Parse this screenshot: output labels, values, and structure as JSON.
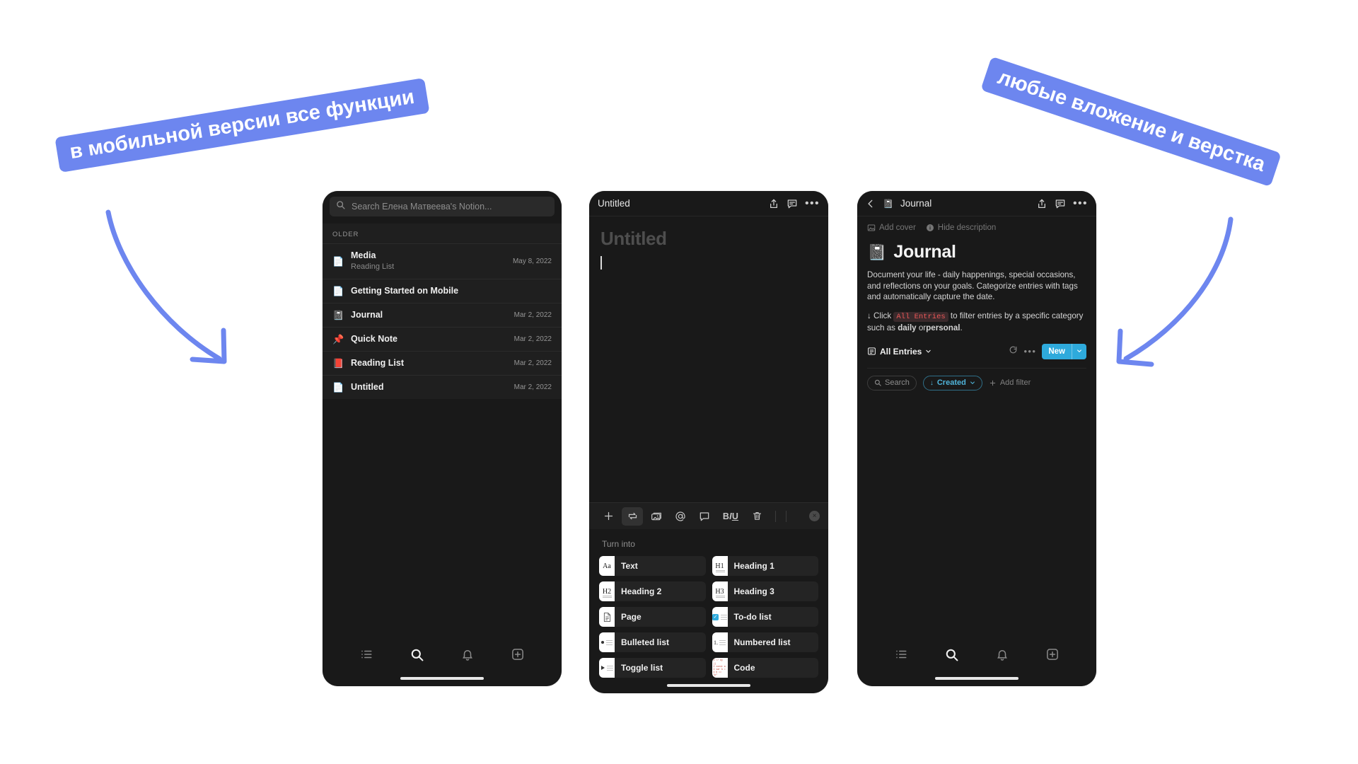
{
  "annotations": {
    "left_banner": "в мобильной версии все функции",
    "right_banner": "любые вложение и верстка",
    "accent_color": "#6d86ef"
  },
  "phone_search": {
    "search": {
      "placeholder": "Search Елена Матвеева's Notion...",
      "icon": "search-icon",
      "value": ""
    },
    "section_label": "OLDER",
    "results": [
      {
        "icon": "page-icon",
        "emoji": "📄",
        "name": "Media",
        "subtitle": "Reading List",
        "date": "May 8, 2022"
      },
      {
        "icon": "page-icon",
        "emoji": "📄",
        "name": "Getting Started on Mobile",
        "subtitle": "",
        "date": ""
      },
      {
        "icon": "notebook-icon",
        "emoji": "📓",
        "name": "Journal",
        "subtitle": "",
        "date": "Mar 2, 2022"
      },
      {
        "icon": "pushpin-icon",
        "emoji": "📌",
        "name": "Quick Note",
        "subtitle": "",
        "date": "Mar 2, 2022"
      },
      {
        "icon": "book-icon",
        "emoji": "📕",
        "name": "Reading List",
        "subtitle": "",
        "date": "Mar 2, 2022"
      },
      {
        "icon": "blank-page-icon",
        "emoji": "📄",
        "name": "Untitled",
        "subtitle": "",
        "date": "Mar 2, 2022"
      }
    ],
    "bottom_nav": [
      {
        "icon": "list-icon",
        "label": "List",
        "active": false
      },
      {
        "icon": "search-icon",
        "label": "Search",
        "active": true
      },
      {
        "icon": "bell-icon",
        "label": "Notifications",
        "active": false
      },
      {
        "icon": "plus-square-icon",
        "label": "New",
        "active": false
      }
    ]
  },
  "phone_editor": {
    "header": {
      "title": "Untitled",
      "share_icon": "share-icon",
      "comment_icon": "comment-icon",
      "more_icon": "more-icon"
    },
    "page_title_placeholder": "Untitled",
    "format_toolbar": [
      {
        "icon": "plus-icon",
        "label": "Add block",
        "selected": false
      },
      {
        "icon": "turn-into-icon",
        "label": "Turn into",
        "selected": true
      },
      {
        "icon": "image-icon",
        "label": "Media",
        "selected": false
      },
      {
        "icon": "mention-icon",
        "label": "Mention",
        "selected": false
      },
      {
        "icon": "comment-icon",
        "label": "Comment",
        "selected": false
      },
      {
        "icon": "biu-icon",
        "label": "BIU",
        "selected": false
      },
      {
        "icon": "trash-icon",
        "label": "Delete",
        "selected": false
      }
    ],
    "close_label": "×",
    "turn_into_label": "Turn into",
    "turn_into_options": [
      {
        "icon": "text-icon",
        "glyph": "Aa",
        "label": "Text"
      },
      {
        "icon": "heading-1-icon",
        "glyph": "H1",
        "label": "Heading 1"
      },
      {
        "icon": "heading-2-icon",
        "glyph": "H2",
        "label": "Heading 2"
      },
      {
        "icon": "heading-3-icon",
        "glyph": "H3",
        "label": "Heading 3"
      },
      {
        "icon": "page-icon",
        "glyph": "",
        "label": "Page"
      },
      {
        "icon": "todo-list-icon",
        "glyph": "",
        "label": "To-do list"
      },
      {
        "icon": "bulleted-list-icon",
        "glyph": "",
        "label": "Bulleted list"
      },
      {
        "icon": "numbered-list-icon",
        "glyph": "1.",
        "label": "Numbered list"
      },
      {
        "icon": "toggle-list-icon",
        "glyph": "",
        "label": "Toggle list"
      },
      {
        "icon": "code-icon",
        "glyph": "",
        "label": "Code"
      }
    ]
  },
  "phone_journal": {
    "header": {
      "back_icon": "back-chevron-icon",
      "page_icon": "notebook-icon",
      "title": "Journal",
      "share_icon": "share-icon",
      "comment_icon": "comment-icon",
      "more_icon": "more-icon"
    },
    "meta_actions": [
      {
        "icon": "image-icon",
        "label": "Add cover"
      },
      {
        "icon": "info-icon",
        "label": "Hide description"
      }
    ],
    "page_emoji": "📓",
    "page_title": "Journal",
    "description": "Document your life - daily happenings, special occasions, and reflections on your goals. Categorize entries with tags and automatically capture the date.",
    "hint": {
      "prefix": "↓ Click",
      "code": "All Entries",
      "middle": "to filter entries by a specific category such as",
      "bold_1": "daily",
      "or": "or",
      "bold_2": "personal",
      "suffix": "."
    },
    "database": {
      "view_icon": "database-view-icon",
      "view_name": "All Entries",
      "view_chevron": "chevron-down-icon",
      "refresh_icon": "refresh-icon",
      "more_icon": "more-icon",
      "new_label": "New",
      "new_chevron": "chevron-down-icon",
      "new_color": "#2eaadc",
      "search_label": "Search",
      "search_icon": "search-icon",
      "sort_label": "Created",
      "sort_icon": "sort-desc-icon",
      "add_filter_label": "Add filter",
      "add_filter_icon": "plus-icon"
    },
    "bottom_nav": [
      {
        "icon": "list-icon",
        "label": "List",
        "active": false
      },
      {
        "icon": "search-icon",
        "label": "Search",
        "active": true
      },
      {
        "icon": "bell-icon",
        "label": "Notifications",
        "active": false
      },
      {
        "icon": "plus-square-icon",
        "label": "New",
        "active": false
      }
    ]
  }
}
